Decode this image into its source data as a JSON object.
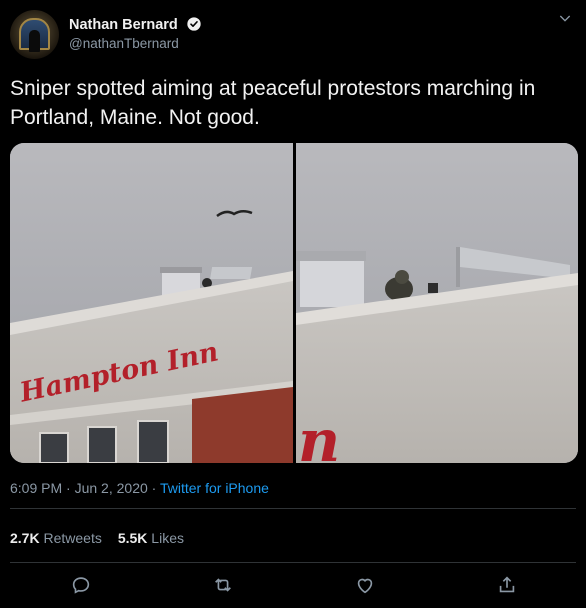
{
  "author": {
    "name": "Nathan Bernard",
    "handle": "@nathanTbernard",
    "verified": true
  },
  "tweet": {
    "text": "Sniper spotted aiming at peaceful protestors marching in Portland, Maine. Not good.",
    "time": "6:09 PM",
    "date": "Jun 2, 2020",
    "source": "Twitter for iPhone",
    "separator": "·"
  },
  "media": {
    "sign_text": "Hampton Inn",
    "sign_fragment": "n"
  },
  "stats": {
    "retweets_count": "2.7K",
    "retweets_label": "Retweets",
    "likes_count": "5.5K",
    "likes_label": "Likes"
  },
  "icons": {
    "reply": "reply-icon",
    "retweet": "retweet-icon",
    "like": "heart-icon",
    "share": "share-icon",
    "more": "chevron-down-icon"
  },
  "colors": {
    "background": "#000000",
    "link": "#1d9bf0",
    "muted": "#8b98a5",
    "verified": "#ffffff",
    "sign_red": "#b3202a"
  }
}
